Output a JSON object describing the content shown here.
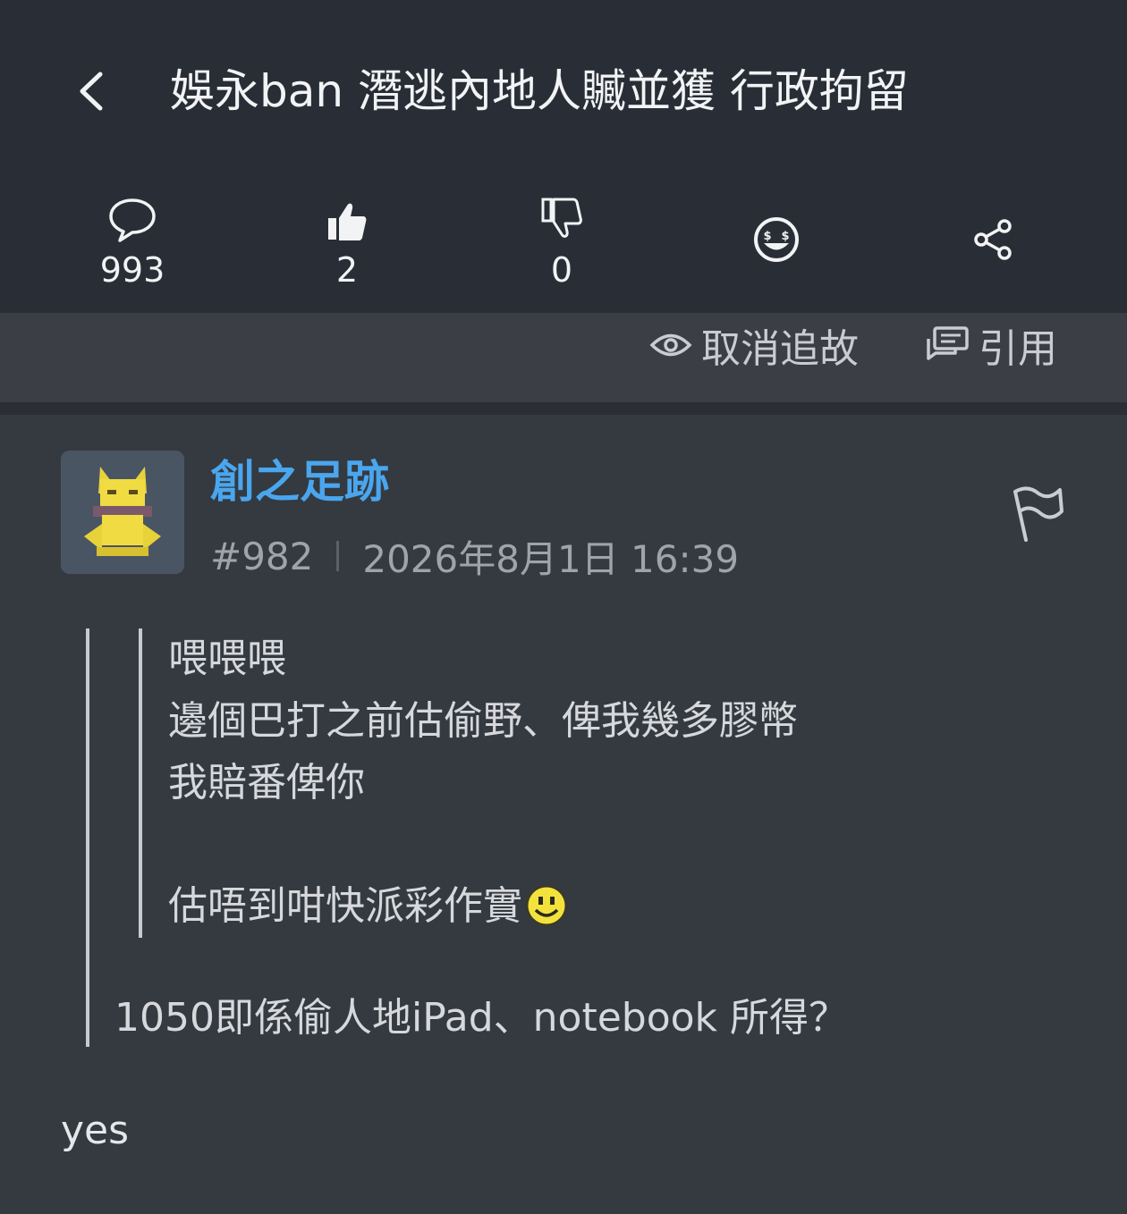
{
  "header": {
    "title": "娛永ban 潛逃內地人贓並獲 行政拘留",
    "comments_count": "993",
    "likes_count": "2",
    "dislikes_count": "0"
  },
  "actions": {
    "unfollow_label": "取消追故",
    "quote_label": "引用"
  },
  "post": {
    "username": "創之足跡",
    "floor": "#982",
    "datetime": "2026年8月1日 16:39",
    "inner_quote_lines": [
      "喂喂喂",
      "邊個巴打之前估偷野、俾我幾多膠幣",
      "我賠番俾你",
      "",
      "估唔到咁快派彩作實"
    ],
    "outer_quote": "1050即係偷人地iPad、notebook 所得？",
    "reply": "yes"
  },
  "colors": {
    "topbar_bg": "#292e36",
    "post_bg": "#343a40",
    "username": "#4aa6ee"
  },
  "icons": [
    "back-chevron-icon",
    "comment-bubble-icon",
    "thumbs-up-icon",
    "thumbs-down-icon",
    "money-face-icon",
    "share-icon",
    "eye-icon",
    "quote-icon",
    "flag-icon",
    "smiley-icon"
  ]
}
